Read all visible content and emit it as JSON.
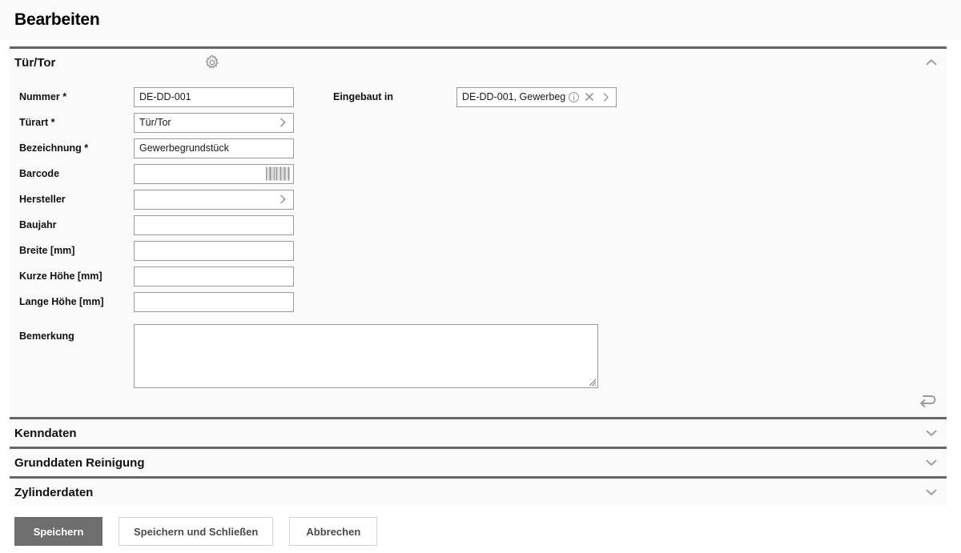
{
  "page": {
    "title": "Bearbeiten"
  },
  "sections": {
    "main": {
      "title": "Tür/Tor",
      "gear_icon": "gear-icon",
      "collapse_icon": "chevron-up-icon",
      "undo_icon": "undo-icon",
      "fields": [
        {
          "label": "Nummer",
          "required_marker": " *",
          "value": "DE-DD-001",
          "type": "text"
        },
        {
          "label": "Türart",
          "required_marker": " *",
          "value": "Tür/Tor",
          "type": "picker"
        },
        {
          "label": "Bezeichnung",
          "required_marker": " *",
          "value": "Gewerbegrundstück",
          "type": "text"
        },
        {
          "label": "Barcode",
          "required_marker": "",
          "value": "",
          "type": "barcode"
        },
        {
          "label": "Hersteller",
          "required_marker": "",
          "value": "",
          "type": "picker"
        },
        {
          "label": "Baujahr",
          "required_marker": "",
          "value": "",
          "type": "text"
        },
        {
          "label": "Breite [mm]",
          "required_marker": "",
          "value": "",
          "type": "text"
        },
        {
          "label": "Kurze Höhe [mm]",
          "required_marker": "",
          "value": "",
          "type": "text"
        },
        {
          "label": "Lange Höhe [mm]",
          "required_marker": "",
          "value": "",
          "type": "text"
        }
      ],
      "remark": {
        "label": "Bemerkung",
        "value": "",
        "placeholder": ""
      },
      "lookup": {
        "label": "Eingebaut in",
        "value": "DE-DD-001, Gewerbeg",
        "info_icon": "info-icon",
        "clear_icon": "close-icon",
        "open_icon": "chevron-right-icon"
      }
    },
    "collapsed": [
      {
        "title": "Kenndaten",
        "expand_icon": "chevron-down-icon"
      },
      {
        "title": "Grunddaten Reinigung",
        "expand_icon": "chevron-down-icon"
      },
      {
        "title": "Zylinderdaten",
        "expand_icon": "chevron-down-icon"
      }
    ]
  },
  "buttons": {
    "save": "Speichern",
    "save_and_close": "Speichern und Schließen",
    "cancel": "Abbrechen"
  },
  "colors": {
    "primary_button": "#6e6e6e",
    "section_rule": "#666666",
    "panel_background": "#fafafa",
    "field_border": "#9a9a9a",
    "icon_grey": "#9b9b9b"
  }
}
